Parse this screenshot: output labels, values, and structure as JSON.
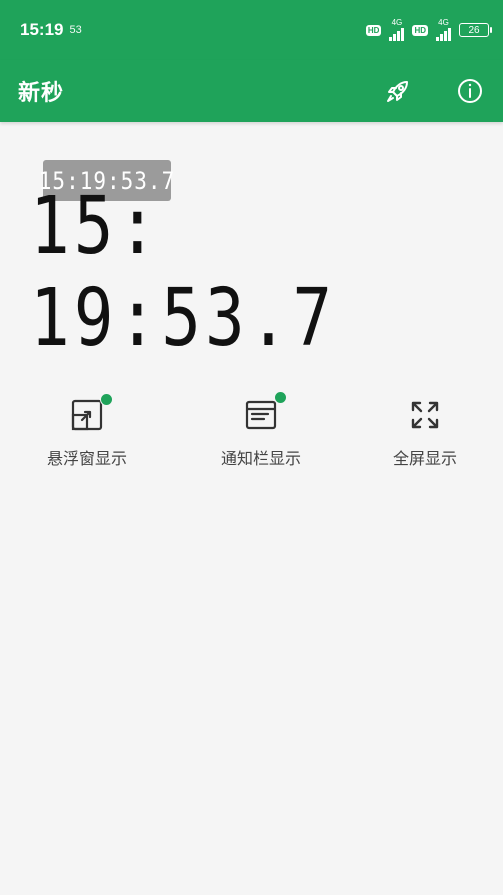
{
  "status_bar": {
    "time": "15:19",
    "extra": "53",
    "hd_label": "HD",
    "network_label": "4G",
    "battery": "26"
  },
  "app_bar": {
    "title": "新秒",
    "actions": [
      "rocket-icon",
      "info-icon"
    ]
  },
  "clock": {
    "small_time": "15:19:53.7",
    "large_time": "15: 19:53.7"
  },
  "actions": [
    {
      "label": "悬浮窗显示",
      "icon": "floating-window-icon",
      "active": true
    },
    {
      "label": "通知栏显示",
      "icon": "notification-bar-icon",
      "active": true
    },
    {
      "label": "全屏显示",
      "icon": "fullscreen-icon",
      "active": false
    }
  ],
  "colors": {
    "primary": "#1fa35a",
    "background": "#f5f5f5",
    "badge": "#9b9b9b",
    "text": "#111111"
  }
}
